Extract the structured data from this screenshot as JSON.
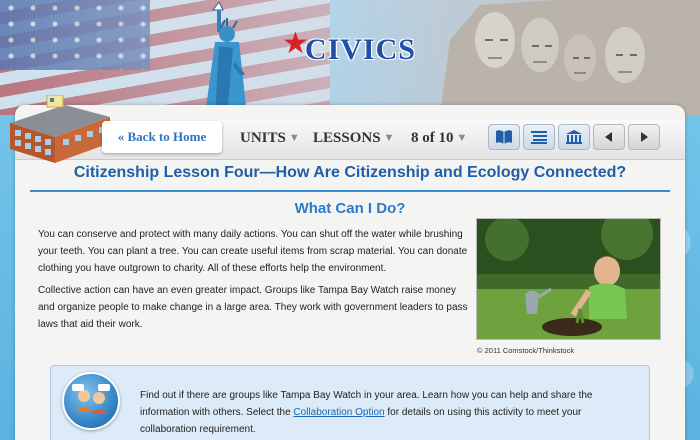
{
  "header": {
    "logo_text": "CIVICS"
  },
  "nav": {
    "back_label": "« Back to Home",
    "units_label": "UNITS",
    "lessons_label": "LESSONS",
    "page_indicator": "8 of 10",
    "buttons": {
      "book_icon": "book-icon",
      "list_icon": "list-icon",
      "capitol_icon": "building-icon",
      "prev_icon": "left-arrow-icon",
      "next_icon": "right-arrow-icon"
    }
  },
  "lesson": {
    "title": "Citizenship Lesson Four—How Are Citizenship and Ecology Connected?",
    "section_heading": "What Can I Do?",
    "paragraph1": "You can conserve and protect with many daily actions. You can shut off the water while brushing your teeth. You can plant a tree. You can create useful items from scrap material. You can donate clothing you have outgrown to charity. All of these efforts help the environment.",
    "paragraph2": "Collective action can have an even greater impact. Groups like Tampa Bay Watch raise money and organize people to make change in a large area. They work with government leaders to pass laws that aid their work.",
    "photo_caption": "© 2011 Comstock/Thinkstock"
  },
  "collaboration": {
    "text_before": "Find out if there are groups like Tampa Bay Watch in your area. Learn how you can help and share the information with others. Select the ",
    "link_text": "Collaboration Option",
    "text_after": " for details on using this activity to meet your collaboration requirement."
  },
  "colors": {
    "accent_blue": "#1f5ea8",
    "heading_blue": "#2a7ccb",
    "logo_red": "#d8202a"
  }
}
